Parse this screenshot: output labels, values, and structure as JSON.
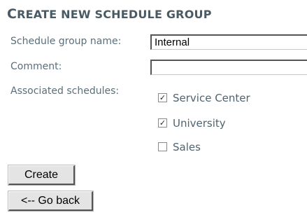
{
  "form": {
    "title_first_letter": "C",
    "title_rest": "REATE NEW SCHEDULE GROUP",
    "name_label": "Schedule group name:",
    "name_value": "Internal",
    "comment_label": "Comment:",
    "comment_value": "",
    "schedules_label": "Associated schedules:",
    "schedules": [
      {
        "label": "Service Center",
        "checked": true,
        "mark": "✓"
      },
      {
        "label": "University",
        "checked": true,
        "mark": "✓"
      },
      {
        "label": "Sales",
        "checked": false,
        "mark": ""
      }
    ],
    "create_label": "Create",
    "back_label": "<-- Go back"
  }
}
